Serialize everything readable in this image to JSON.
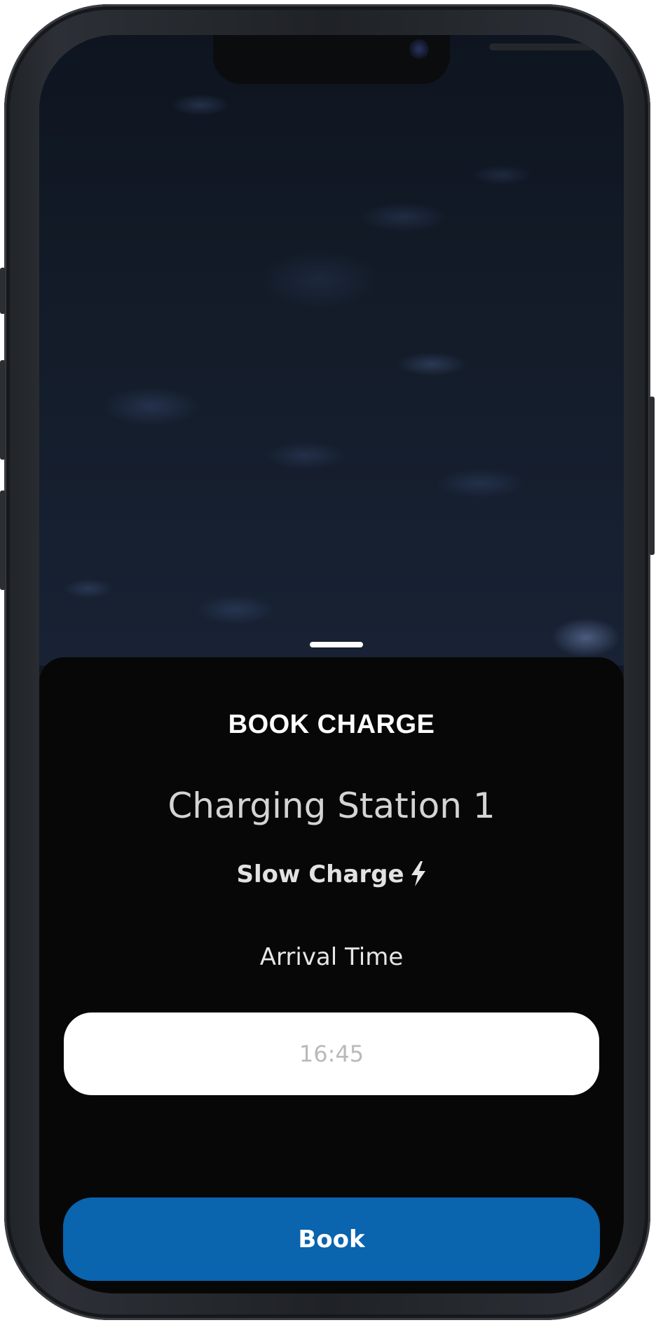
{
  "sheet": {
    "title": "BOOK CHARGE",
    "station_name": "Charging Station 1",
    "charge_type": "Slow Charge",
    "charge_icon": "lightning-bolt-icon",
    "arrival_label": "Arrival Time",
    "arrival_time_value": "16:45",
    "book_label": "Book"
  },
  "colors": {
    "accent": "#0a64ae",
    "sheet_background": "#070707",
    "input_background": "#ffffff",
    "input_text": "#b9b9b9"
  }
}
